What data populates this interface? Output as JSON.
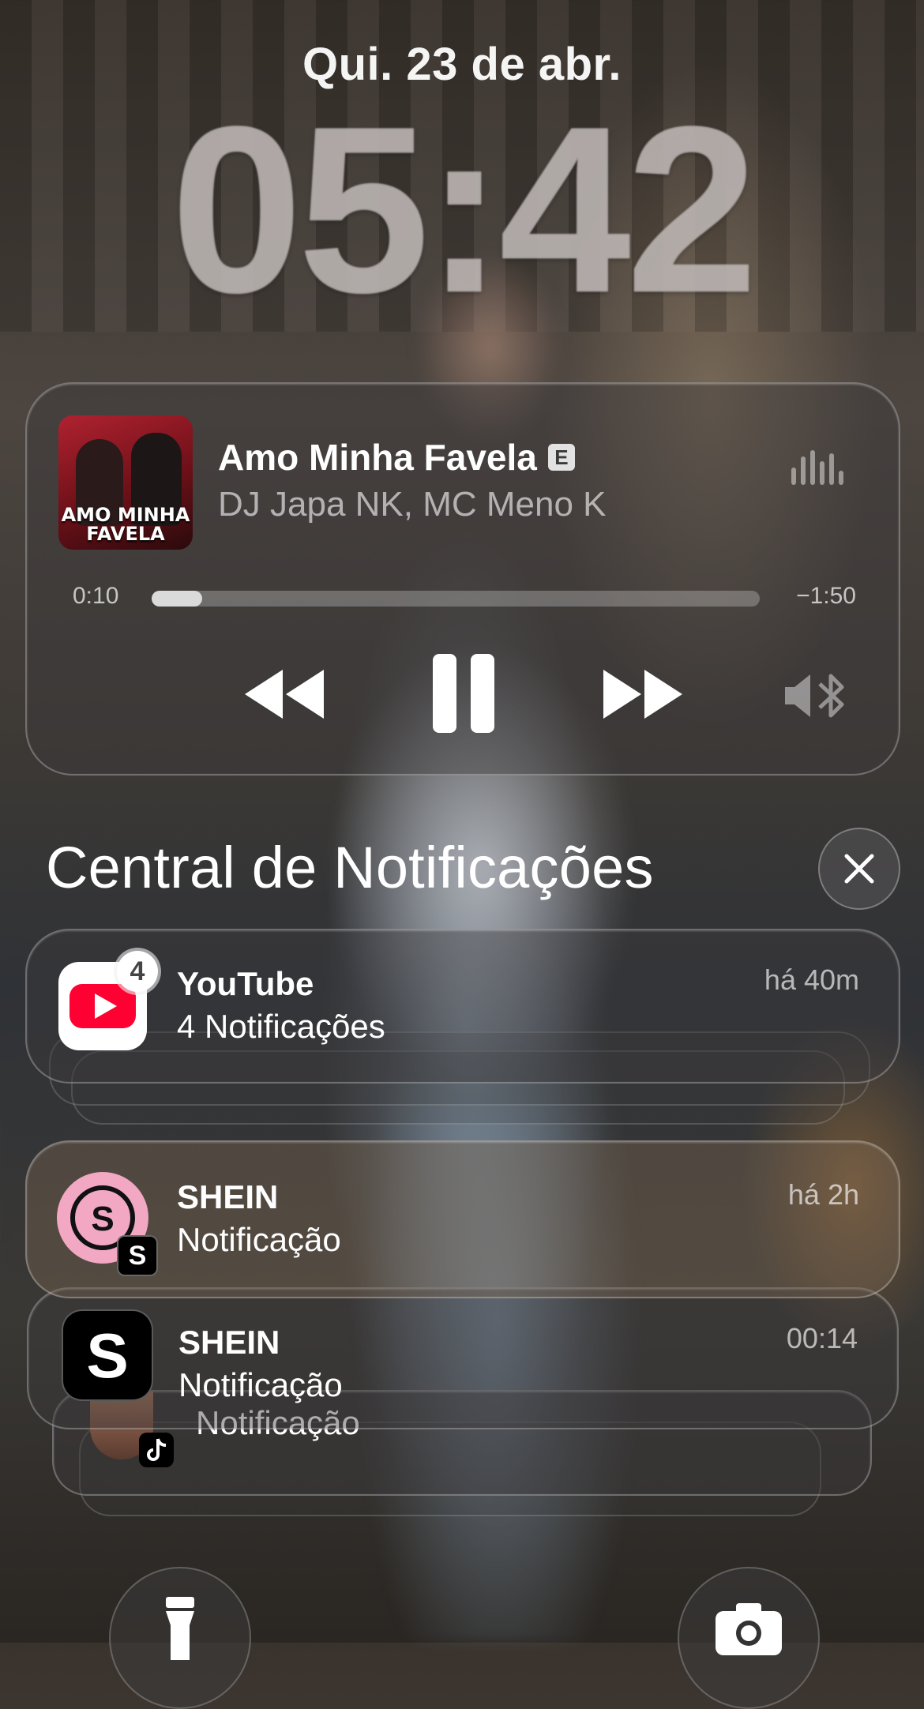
{
  "lock_screen": {
    "date": "Qui. 23 de abr.",
    "time": "05:42"
  },
  "now_playing": {
    "album_art_text": "AMO MINHA FAVELA",
    "title": "Amo Minha Favela",
    "explicit_badge": "E",
    "artist": "DJ Japa NK, MC Meno K",
    "elapsed": "0:10",
    "remaining": "−1:50",
    "progress_fraction": 0.083,
    "icons": [
      "waveform-icon",
      "rewind-icon",
      "pause-icon",
      "fast-forward-icon",
      "bluetooth-speaker-icon"
    ]
  },
  "notification_center": {
    "title": "Central de Notificações",
    "close_icon": "close-icon",
    "notifications": [
      {
        "app": "YouTube",
        "body": "4 Notificações",
        "time": "há 40m",
        "badge": "4",
        "icon": "youtube-icon",
        "accent": "#ff0033"
      },
      {
        "app": "SHEIN",
        "body": "Notificação",
        "time": "há 2h",
        "icon": "sheglam-icon",
        "accent": "#f2a7c3"
      },
      {
        "app": "SHEIN",
        "body": "Notificação",
        "time": "00:14",
        "icon": "shein-icon",
        "accent": "#000000"
      },
      {
        "body": "Notificação",
        "icon": "tiktok-icon"
      }
    ]
  },
  "quick_actions": {
    "left": "flashlight-icon",
    "right": "camera-icon"
  }
}
